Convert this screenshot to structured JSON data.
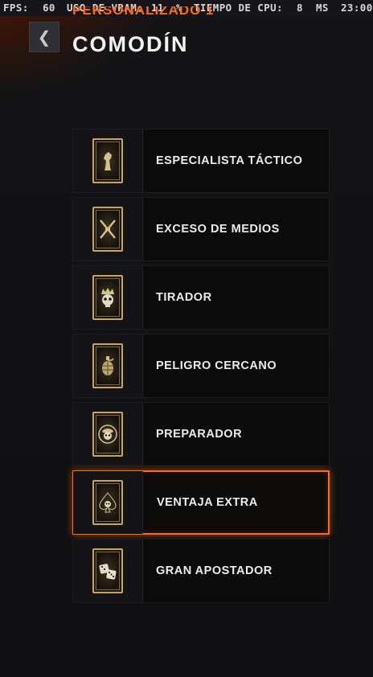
{
  "hud": {
    "fps_label": "FPS:",
    "fps_value": "60",
    "vram_label": "USO DE VRAM:",
    "vram_value": "11",
    "vram_unit": "%",
    "cpu_label": "TIEMPO DE CPU:",
    "cpu_value": "8",
    "cpu_unit": "MS",
    "clock": "23:00"
  },
  "header": {
    "back_icon": "chevron-left-icon",
    "subtitle": "PERSONALIZADO 1",
    "title": "COMODÍN"
  },
  "wildcards": [
    {
      "label": "ESPECIALISTA TÁCTICO",
      "icon": "chess-knight-icon",
      "selected": false
    },
    {
      "label": "EXCESO DE MEDIOS",
      "icon": "crossed-rifles-icon",
      "selected": false
    },
    {
      "label": "TIRADOR",
      "icon": "crowned-skull-icon",
      "selected": false
    },
    {
      "label": "PELIGRO CERCANO",
      "icon": "grenade-icon",
      "selected": false
    },
    {
      "label": "PREPARADOR",
      "icon": "skull-emblem-icon",
      "selected": false
    },
    {
      "label": "VENTAJA EXTRA",
      "icon": "spade-skull-icon",
      "selected": true
    },
    {
      "label": "GRAN APOSTADOR",
      "icon": "dice-icon",
      "selected": false
    }
  ],
  "colors": {
    "accent": "#ff6a13",
    "card_gold": "#c9a55b",
    "panel": "#0b0b0c"
  }
}
